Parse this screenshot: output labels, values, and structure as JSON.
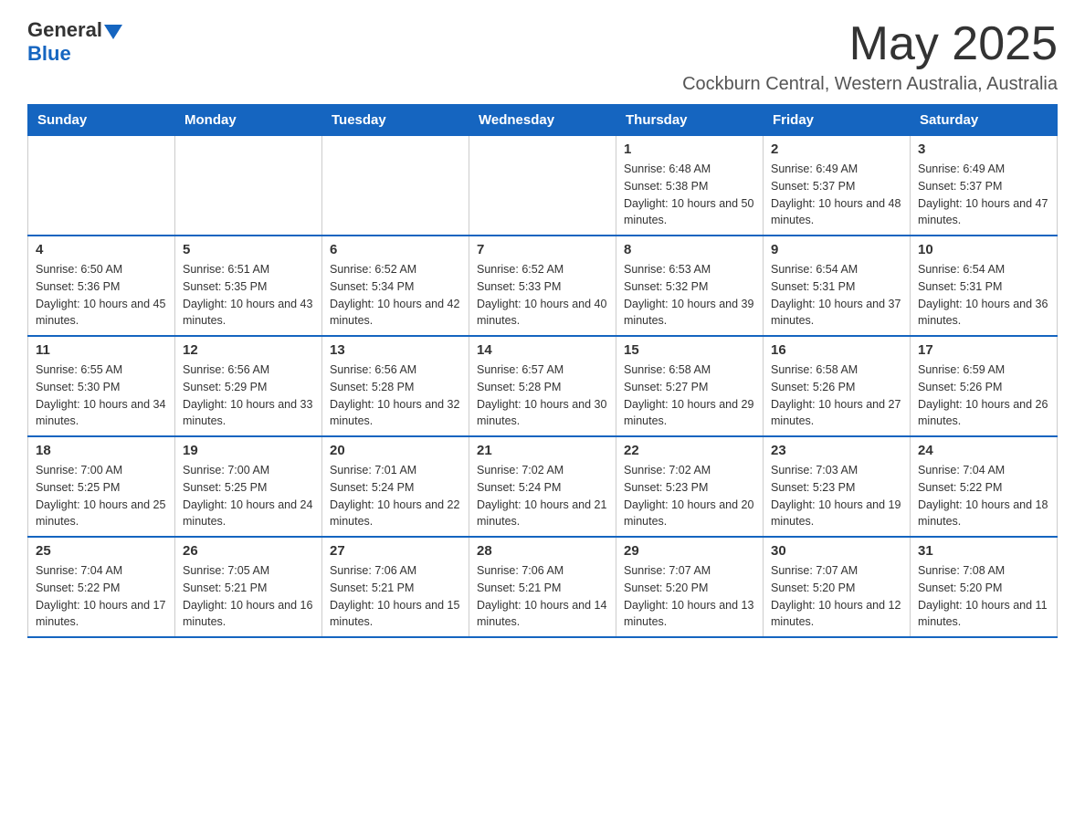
{
  "header": {
    "logo_general": "General",
    "logo_blue": "Blue",
    "month_title": "May 2025",
    "location": "Cockburn Central, Western Australia, Australia"
  },
  "weekdays": [
    "Sunday",
    "Monday",
    "Tuesday",
    "Wednesday",
    "Thursday",
    "Friday",
    "Saturday"
  ],
  "weeks": [
    [
      {
        "day": "",
        "sunrise": "",
        "sunset": "",
        "daylight": ""
      },
      {
        "day": "",
        "sunrise": "",
        "sunset": "",
        "daylight": ""
      },
      {
        "day": "",
        "sunrise": "",
        "sunset": "",
        "daylight": ""
      },
      {
        "day": "",
        "sunrise": "",
        "sunset": "",
        "daylight": ""
      },
      {
        "day": "1",
        "sunrise": "Sunrise: 6:48 AM",
        "sunset": "Sunset: 5:38 PM",
        "daylight": "Daylight: 10 hours and 50 minutes."
      },
      {
        "day": "2",
        "sunrise": "Sunrise: 6:49 AM",
        "sunset": "Sunset: 5:37 PM",
        "daylight": "Daylight: 10 hours and 48 minutes."
      },
      {
        "day": "3",
        "sunrise": "Sunrise: 6:49 AM",
        "sunset": "Sunset: 5:37 PM",
        "daylight": "Daylight: 10 hours and 47 minutes."
      }
    ],
    [
      {
        "day": "4",
        "sunrise": "Sunrise: 6:50 AM",
        "sunset": "Sunset: 5:36 PM",
        "daylight": "Daylight: 10 hours and 45 minutes."
      },
      {
        "day": "5",
        "sunrise": "Sunrise: 6:51 AM",
        "sunset": "Sunset: 5:35 PM",
        "daylight": "Daylight: 10 hours and 43 minutes."
      },
      {
        "day": "6",
        "sunrise": "Sunrise: 6:52 AM",
        "sunset": "Sunset: 5:34 PM",
        "daylight": "Daylight: 10 hours and 42 minutes."
      },
      {
        "day": "7",
        "sunrise": "Sunrise: 6:52 AM",
        "sunset": "Sunset: 5:33 PM",
        "daylight": "Daylight: 10 hours and 40 minutes."
      },
      {
        "day": "8",
        "sunrise": "Sunrise: 6:53 AM",
        "sunset": "Sunset: 5:32 PM",
        "daylight": "Daylight: 10 hours and 39 minutes."
      },
      {
        "day": "9",
        "sunrise": "Sunrise: 6:54 AM",
        "sunset": "Sunset: 5:31 PM",
        "daylight": "Daylight: 10 hours and 37 minutes."
      },
      {
        "day": "10",
        "sunrise": "Sunrise: 6:54 AM",
        "sunset": "Sunset: 5:31 PM",
        "daylight": "Daylight: 10 hours and 36 minutes."
      }
    ],
    [
      {
        "day": "11",
        "sunrise": "Sunrise: 6:55 AM",
        "sunset": "Sunset: 5:30 PM",
        "daylight": "Daylight: 10 hours and 34 minutes."
      },
      {
        "day": "12",
        "sunrise": "Sunrise: 6:56 AM",
        "sunset": "Sunset: 5:29 PM",
        "daylight": "Daylight: 10 hours and 33 minutes."
      },
      {
        "day": "13",
        "sunrise": "Sunrise: 6:56 AM",
        "sunset": "Sunset: 5:28 PM",
        "daylight": "Daylight: 10 hours and 32 minutes."
      },
      {
        "day": "14",
        "sunrise": "Sunrise: 6:57 AM",
        "sunset": "Sunset: 5:28 PM",
        "daylight": "Daylight: 10 hours and 30 minutes."
      },
      {
        "day": "15",
        "sunrise": "Sunrise: 6:58 AM",
        "sunset": "Sunset: 5:27 PM",
        "daylight": "Daylight: 10 hours and 29 minutes."
      },
      {
        "day": "16",
        "sunrise": "Sunrise: 6:58 AM",
        "sunset": "Sunset: 5:26 PM",
        "daylight": "Daylight: 10 hours and 27 minutes."
      },
      {
        "day": "17",
        "sunrise": "Sunrise: 6:59 AM",
        "sunset": "Sunset: 5:26 PM",
        "daylight": "Daylight: 10 hours and 26 minutes."
      }
    ],
    [
      {
        "day": "18",
        "sunrise": "Sunrise: 7:00 AM",
        "sunset": "Sunset: 5:25 PM",
        "daylight": "Daylight: 10 hours and 25 minutes."
      },
      {
        "day": "19",
        "sunrise": "Sunrise: 7:00 AM",
        "sunset": "Sunset: 5:25 PM",
        "daylight": "Daylight: 10 hours and 24 minutes."
      },
      {
        "day": "20",
        "sunrise": "Sunrise: 7:01 AM",
        "sunset": "Sunset: 5:24 PM",
        "daylight": "Daylight: 10 hours and 22 minutes."
      },
      {
        "day": "21",
        "sunrise": "Sunrise: 7:02 AM",
        "sunset": "Sunset: 5:24 PM",
        "daylight": "Daylight: 10 hours and 21 minutes."
      },
      {
        "day": "22",
        "sunrise": "Sunrise: 7:02 AM",
        "sunset": "Sunset: 5:23 PM",
        "daylight": "Daylight: 10 hours and 20 minutes."
      },
      {
        "day": "23",
        "sunrise": "Sunrise: 7:03 AM",
        "sunset": "Sunset: 5:23 PM",
        "daylight": "Daylight: 10 hours and 19 minutes."
      },
      {
        "day": "24",
        "sunrise": "Sunrise: 7:04 AM",
        "sunset": "Sunset: 5:22 PM",
        "daylight": "Daylight: 10 hours and 18 minutes."
      }
    ],
    [
      {
        "day": "25",
        "sunrise": "Sunrise: 7:04 AM",
        "sunset": "Sunset: 5:22 PM",
        "daylight": "Daylight: 10 hours and 17 minutes."
      },
      {
        "day": "26",
        "sunrise": "Sunrise: 7:05 AM",
        "sunset": "Sunset: 5:21 PM",
        "daylight": "Daylight: 10 hours and 16 minutes."
      },
      {
        "day": "27",
        "sunrise": "Sunrise: 7:06 AM",
        "sunset": "Sunset: 5:21 PM",
        "daylight": "Daylight: 10 hours and 15 minutes."
      },
      {
        "day": "28",
        "sunrise": "Sunrise: 7:06 AM",
        "sunset": "Sunset: 5:21 PM",
        "daylight": "Daylight: 10 hours and 14 minutes."
      },
      {
        "day": "29",
        "sunrise": "Sunrise: 7:07 AM",
        "sunset": "Sunset: 5:20 PM",
        "daylight": "Daylight: 10 hours and 13 minutes."
      },
      {
        "day": "30",
        "sunrise": "Sunrise: 7:07 AM",
        "sunset": "Sunset: 5:20 PM",
        "daylight": "Daylight: 10 hours and 12 minutes."
      },
      {
        "day": "31",
        "sunrise": "Sunrise: 7:08 AM",
        "sunset": "Sunset: 5:20 PM",
        "daylight": "Daylight: 10 hours and 11 minutes."
      }
    ]
  ]
}
